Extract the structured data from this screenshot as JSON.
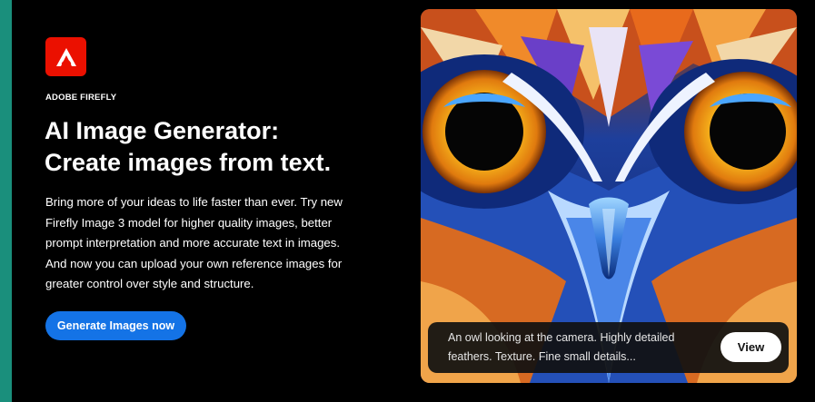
{
  "hero": {
    "brand_label": "ADOBE FIREFLY",
    "headline_line1": "AI Image Generator:",
    "headline_line2": "Create images from text.",
    "description": "Bring more of your ideas to life faster than ever. Try new Firefly Image 3 model for higher quality images, better prompt interpretation and more accurate text in images. And now you can upload your own reference images for greater control over style and structure.",
    "cta_label": "Generate Images now",
    "logo_icon": "adobe-firefly-logo",
    "logo_color": "#eb1000",
    "cta_color": "#1473e6"
  },
  "showcase": {
    "image_subject": "owl-closeup",
    "prompt_line1": "An owl looking at the camera. Highly detailed",
    "prompt_line2": "feathers. Texture. Fine small details...",
    "view_label": "View"
  },
  "colors": {
    "page_background": "#000000",
    "outer_background": "#1a8f7c",
    "text_primary": "#ffffff"
  }
}
